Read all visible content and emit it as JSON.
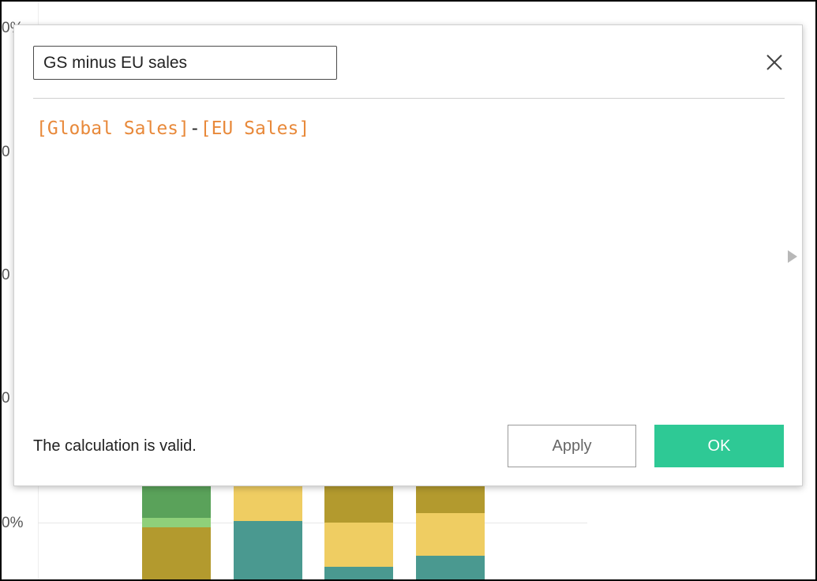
{
  "background": {
    "axis_labels": [
      "0%",
      "0",
      "0",
      "0",
      "0%"
    ],
    "bars": [
      {
        "segments": [
          "#5aa25a",
          "#8fd07a",
          "#b39a2e"
        ]
      },
      {
        "segments": [
          "#efcd62",
          "#4a9990"
        ]
      },
      {
        "segments": [
          "#b39a2e",
          "#efcd62",
          "#4a9990"
        ]
      },
      {
        "segments": [
          "#b39a2e",
          "#efcd62",
          "#4a9990"
        ]
      }
    ]
  },
  "dialog": {
    "name_value": "GS minus EU sales",
    "close_icon": "close-icon",
    "formula": {
      "field1": "[Global Sales]",
      "operator": "-",
      "field2": "[EU Sales]"
    },
    "side_arrow_icon": "triangle-right-icon",
    "status": "The calculation is valid.",
    "apply_label": "Apply",
    "ok_label": "OK"
  },
  "colors": {
    "field": "#e8893a",
    "ok": "#2ec995"
  }
}
